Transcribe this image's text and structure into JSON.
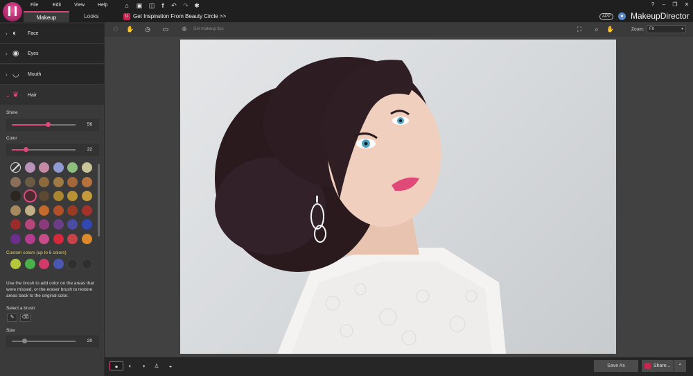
{
  "app": {
    "name": "MakeupDirector",
    "app_badge": "APP"
  },
  "menu": [
    "File",
    "Edit",
    "View",
    "Help"
  ],
  "tabs": [
    {
      "label": "Makeup",
      "active": true
    },
    {
      "label": "Looks",
      "active": false
    }
  ],
  "title_icons": [
    "home-icon",
    "save-icon",
    "share-icon",
    "facebook-icon",
    "undo-icon",
    "redo-icon",
    "settings-icon"
  ],
  "inspiration": {
    "badge": "U",
    "text": "Get Inspiration From Beauty Circle >>"
  },
  "window_controls": [
    "?",
    "–",
    "❐",
    "✕"
  ],
  "categories": [
    {
      "label": "Face",
      "icon": "face-icon"
    },
    {
      "label": "Eyes",
      "icon": "eye-icon"
    },
    {
      "label": "Mouth",
      "icon": "lips-icon"
    },
    {
      "label": "Hair",
      "icon": "hair-icon",
      "open": true
    }
  ],
  "hair": {
    "shine": {
      "label": "Shine",
      "value": 56
    },
    "color": {
      "label": "Color",
      "value": 22
    },
    "swatch_rows": [
      [
        "none",
        "#b993b9",
        "#c48aa6",
        "#8f9bd2",
        "#8fbf7d",
        "#c9c39a"
      ],
      [
        "#8a6f5a",
        "#6b5a44",
        "#8c6a3e",
        "#a07a45",
        "#a4673a",
        "#b6723d"
      ],
      [
        "#2b2520",
        "#4a2a2e",
        "#5b4930",
        "#a9862f",
        "#b79235",
        "#c49a3a"
      ],
      [
        "#a68a5e",
        "#c2b088",
        "#c26a2c",
        "#b24f26",
        "#9b3a22",
        "#a3322a"
      ],
      [
        "#9c2b2b",
        "#b5457a",
        "#8a3b7b",
        "#6a3d86",
        "#4b4ba3",
        "#3347b3"
      ],
      [
        "#6a2f8a",
        "#b43b8e",
        "#c84d8b",
        "#d5283a",
        "#c8424a",
        "#df8a2a"
      ]
    ],
    "selected_swatch": "#4a2a2e",
    "custom_label": "Custom colors (up to 6 colors)",
    "custom_colors": [
      "#b6c63a",
      "#49b04a",
      "#d23a6a",
      "#4a57b3",
      "",
      ""
    ],
    "help_text": "Use the brush to add color on the areas that were missed, or the eraser brush to restore areas back to the original color.",
    "brush_label": "Select a brush",
    "brushes": [
      "brush-add-icon",
      "brush-erase-icon"
    ],
    "size": {
      "label": "Size",
      "value": 20
    }
  },
  "toolbar": {
    "tip_text": "Get makeup tips",
    "zoom_label": "Zoom:",
    "zoom_value": "Fit"
  },
  "bottom": {
    "save_as": "Save As",
    "share": "Share..."
  }
}
